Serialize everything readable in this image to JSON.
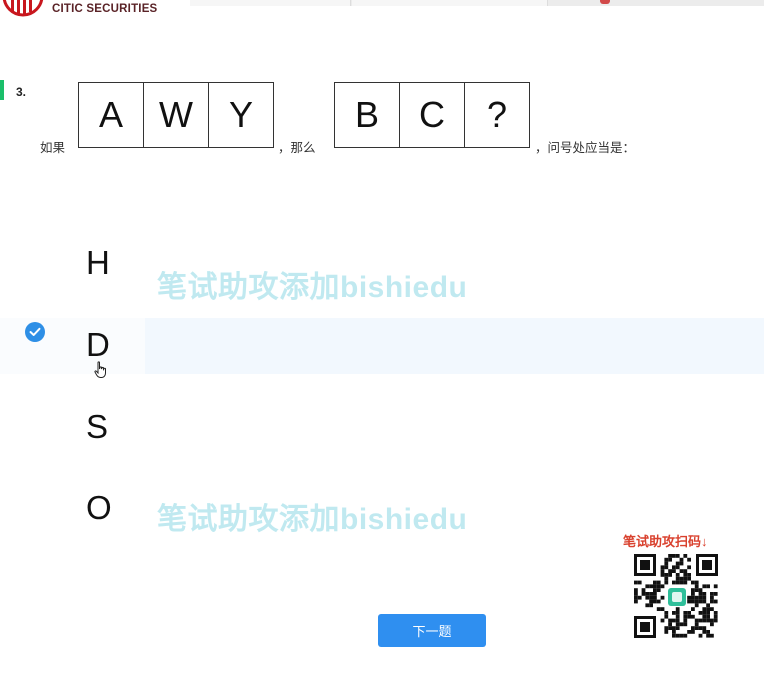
{
  "header": {
    "brand_name": "CITIC SECURITIES"
  },
  "question": {
    "number": "3.",
    "prefix": "如果",
    "mid": "，那么",
    "suffix": "，问号处应当是：",
    "group1": [
      "A",
      "W",
      "Y"
    ],
    "group2": [
      "B",
      "C",
      "?"
    ]
  },
  "options": [
    {
      "label": "H",
      "selected": false
    },
    {
      "label": "D",
      "selected": true
    },
    {
      "label": "S",
      "selected": false
    },
    {
      "label": "O",
      "selected": false
    }
  ],
  "watermark": {
    "text": "笔试助攻添加bishiedu"
  },
  "qr": {
    "label": "笔试助攻扫码↓"
  },
  "next_button": {
    "label": "下一题"
  },
  "colors": {
    "accent": "#2f8ff0",
    "question_marker": "#1bbf6b",
    "watermark": "#b6e6ee",
    "qr_label": "#d9412e"
  }
}
